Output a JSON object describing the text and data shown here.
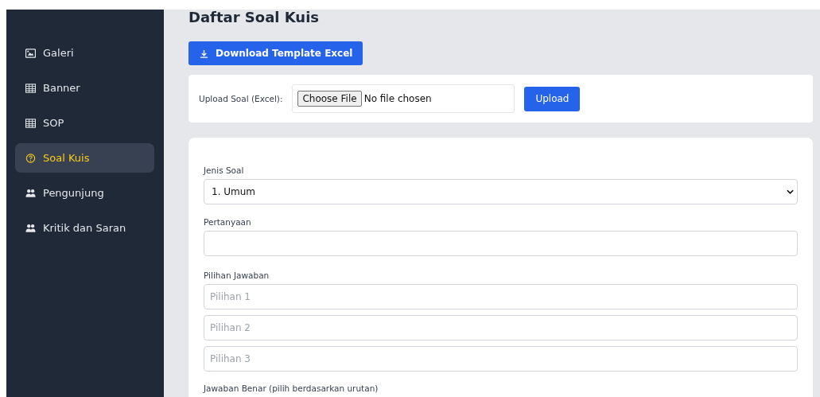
{
  "sidebar": {
    "items": [
      {
        "label": "Galeri",
        "selected": false
      },
      {
        "label": "Banner",
        "selected": false
      },
      {
        "label": "SOP",
        "selected": false
      },
      {
        "label": "Soal Kuis",
        "selected": true
      },
      {
        "label": "Pengunjung",
        "selected": false
      },
      {
        "label": "Kritik dan Saran",
        "selected": false
      }
    ]
  },
  "page_title": "Daftar Soal Kuis",
  "download_button": "Download Template Excel",
  "upload": {
    "label": "Upload Soal (Excel):",
    "choose_button": "Choose File",
    "file_status": "No file chosen",
    "submit_button": "Upload"
  },
  "form": {
    "type_label": "Jenis Soal",
    "type_value": "1. Umum",
    "question_label": "Pertanyaan",
    "choices_label": "Pilihan Jawaban",
    "choices": [
      {
        "placeholder": "Pilihan 1"
      },
      {
        "placeholder": "Pilihan 2"
      },
      {
        "placeholder": "Pilihan 3"
      }
    ],
    "answer_label": "Jawaban Benar (pilih berdasarkan urutan)"
  }
}
